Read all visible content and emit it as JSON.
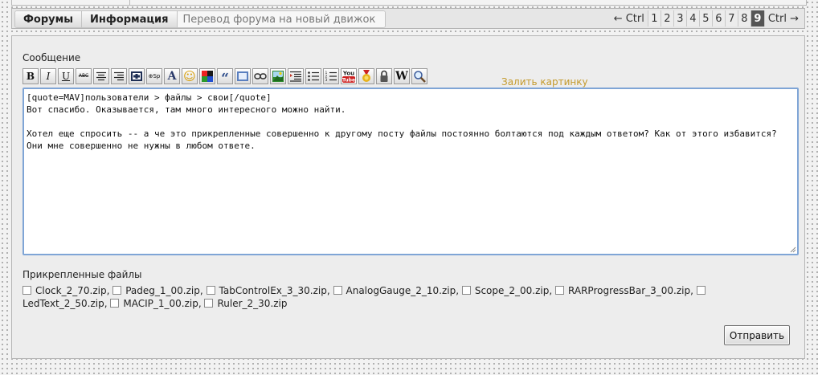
{
  "nav": {
    "tabs": [
      "Форумы",
      "Информация"
    ],
    "current_topic": "Перевод форума на новый движок"
  },
  "pager": {
    "prev_label": "← Ctrl",
    "next_label": "Ctrl →",
    "pages": [
      "1",
      "2",
      "3",
      "4",
      "5",
      "6",
      "7",
      "8",
      "9"
    ],
    "active_page": "9"
  },
  "editor": {
    "label": "Сообщение",
    "upload_link": "Залить картинку",
    "text": "[quote=MAV]пользователи > файлы > свои[/quote]\nВот спасибо. Оказывается, там много интересного можно найти.\n\nХотел еще спросить -- а че это прикрепленные совершенно к другому посту файлы постоянно болтаются под каждым ответом? Как от этого избавится? Они мне совершенно не нужны в любом ответе.",
    "toolbar": {
      "bold": "B",
      "italic": "I",
      "underline": "U",
      "strike": "ABC",
      "code": "⊕Sp",
      "color_text": "A",
      "smiley": "☺",
      "quote": "“",
      "wiki": "W",
      "youtube_top": "You",
      "youtube_bottom": "Tube"
    }
  },
  "attachments": {
    "label": "Прикрепленные файлы",
    "files": [
      "Clock_2_70.zip,",
      "Padeg_1_00.zip,",
      "TabControlEx_3_30.zip,",
      "AnalogGauge_2_10.zip,",
      "Scope_2_00.zip,",
      "RARProgressBar_3_00.zip,",
      "LedText_2_50.zip,",
      "MACIP_1_00.zip,",
      "Ruler_2_30.zip"
    ]
  },
  "submit_label": "Отправить",
  "colors": {
    "editor_border": "#7fa5d6",
    "upload_link": "#c49a2c",
    "active_page_bg": "#555555"
  }
}
